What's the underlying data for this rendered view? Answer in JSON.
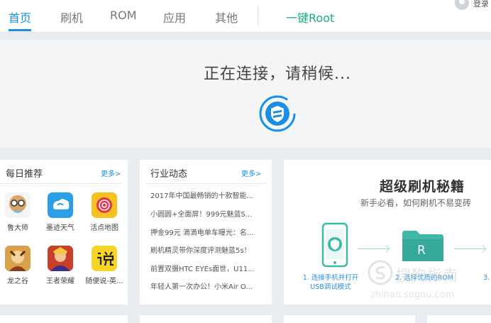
{
  "nav": {
    "items": [
      "首页",
      "刷机",
      "ROM",
      "应用",
      "其他"
    ],
    "root_label": "一键Root",
    "login_label": "登录"
  },
  "connect": {
    "message": "正在连接，请稍候..."
  },
  "daily": {
    "title": "每日推荐",
    "more": "更多>",
    "apps": [
      {
        "name": "鲁大师",
        "icon": "ludashi-icon"
      },
      {
        "name": "墨迹天气",
        "icon": "moji-weather-icon"
      },
      {
        "name": "活点地图",
        "icon": "huodian-map-icon"
      },
      {
        "name": "龙之谷",
        "icon": "dragon-nest-icon"
      },
      {
        "name": "王者荣耀",
        "icon": "honor-of-kings-icon"
      },
      {
        "name": "随便说-英...",
        "icon": "suibianshuo-icon"
      }
    ]
  },
  "news": {
    "title": "行业动态",
    "more": "更多>",
    "items": [
      "2017年中国最畅销的十款智能...",
      "小圆圆+全面屏！999元魅蓝S...",
      "押金99元 滴滴电单车曝光：名...",
      "刷机精灵带你深度评测魅蓝5s！",
      "前置双摄HTC EYEs面世，U11...",
      "年轻人第一次办公！小米Air O..."
    ]
  },
  "promo": {
    "title": "超级刷机秘籍",
    "subtitle": "新手必看，如何刷机不易变砖",
    "step1_line1": "1. 连接手机并打开",
    "step1_line2": "USB调试模式",
    "step2": "2. 选择优质的ROM",
    "step3": "3.",
    "folder_letter": "R"
  },
  "watermark": {
    "text": "搜狗指南",
    "url": "zhinan.sogou.com"
  },
  "colors": {
    "accent": "#1a8fe3",
    "root": "#1aab8a",
    "teal": "#3fb8a8"
  }
}
